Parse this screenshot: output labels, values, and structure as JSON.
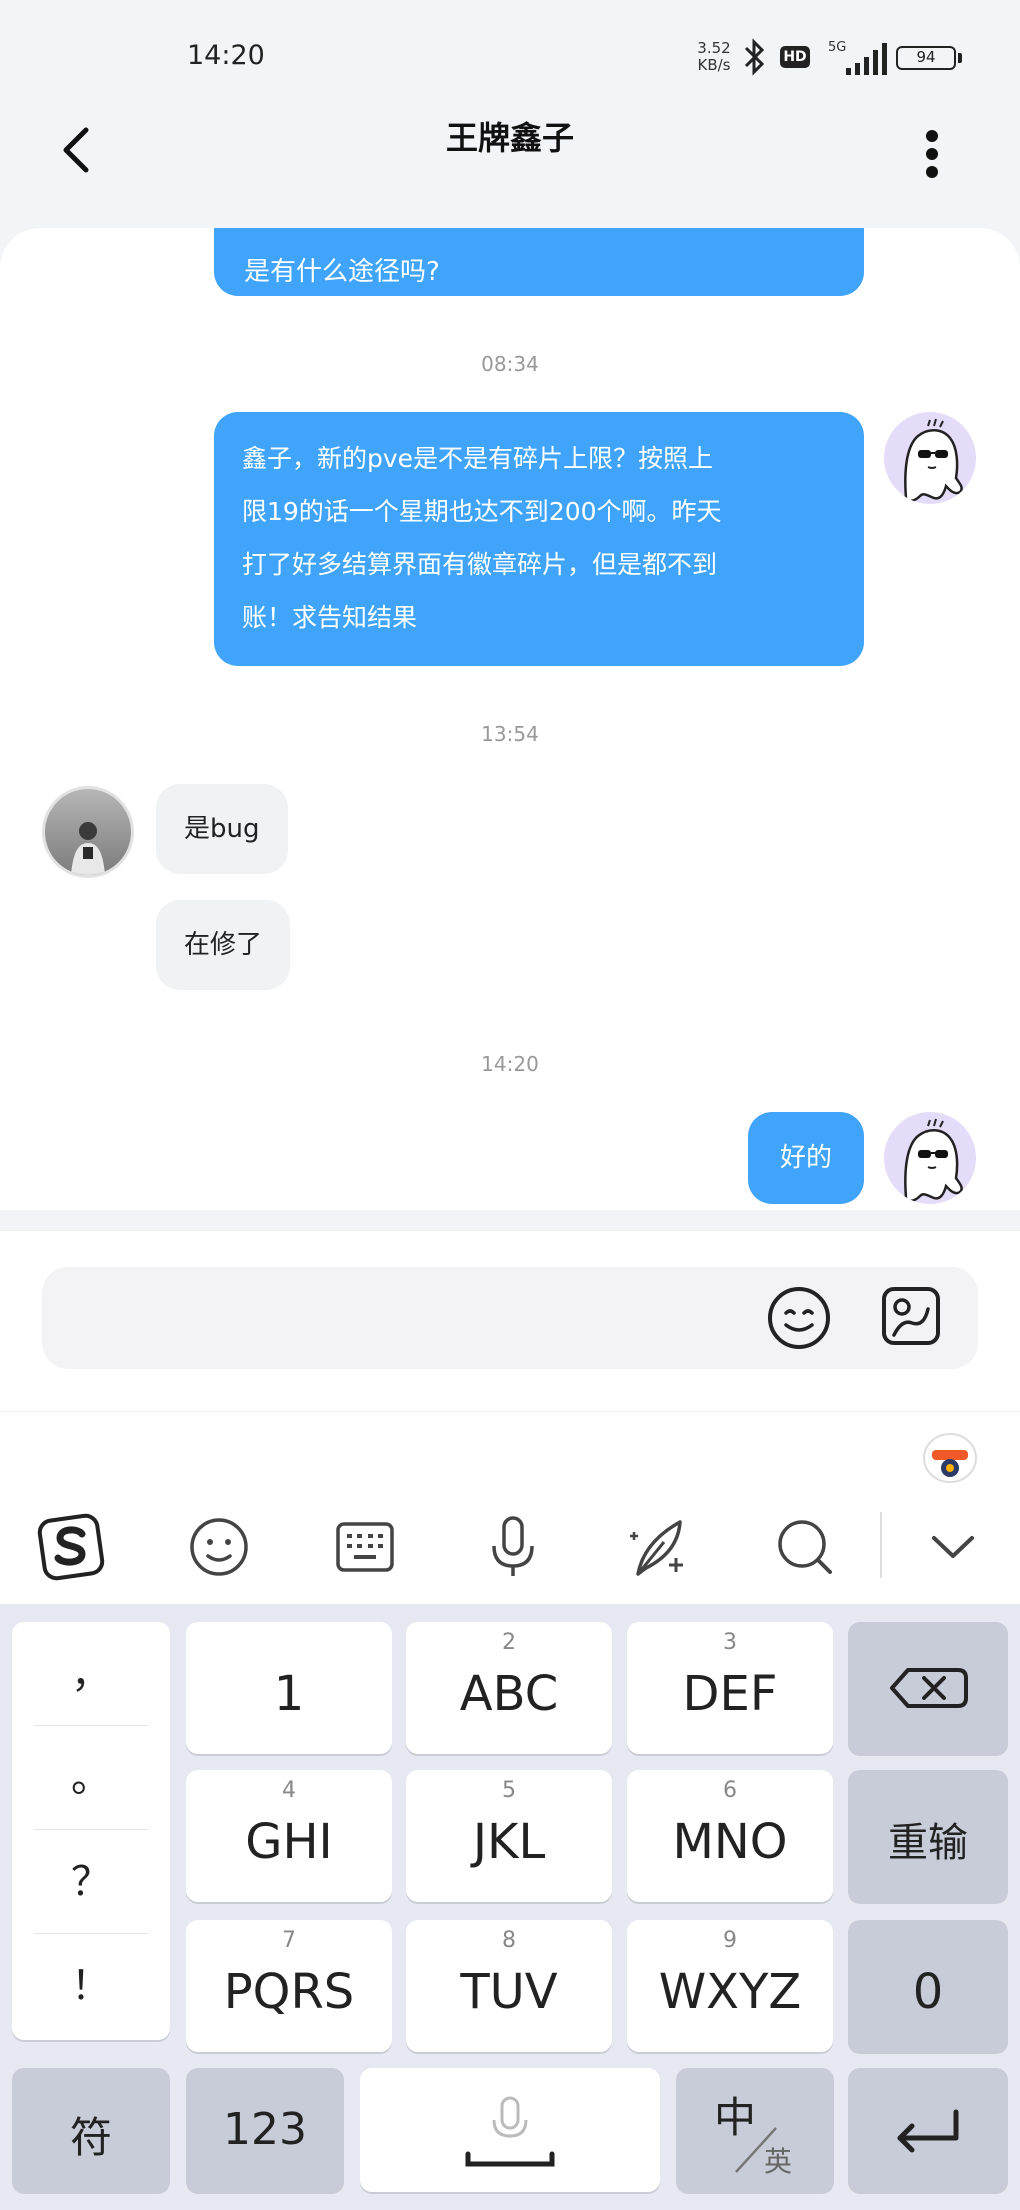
{
  "status_bar": {
    "time": "14:20",
    "net_speed_value": "3.52",
    "net_speed_unit": "KB/s",
    "hd_label": "HD",
    "network_label": "5G",
    "battery": "94"
  },
  "header": {
    "title": "王牌鑫子"
  },
  "chat": {
    "messages": [
      {
        "sender": "me",
        "text": "是有什么途径吗?"
      },
      {
        "time": "08:34"
      },
      {
        "sender": "me",
        "lines": [
          "鑫子，新的pve是不是有碎片上限？按照上",
          "限19的话一个星期也达不到200个啊。昨天",
          "打了好多结算界面有徽章碎片，但是都不到",
          "账！求告知结果"
        ]
      },
      {
        "time": "13:54"
      },
      {
        "sender": "them",
        "text": "是bug"
      },
      {
        "sender": "them",
        "text": "在修了"
      },
      {
        "time": "14:20"
      },
      {
        "sender": "me",
        "text": "好的"
      }
    ]
  },
  "input": {
    "placeholder": ""
  },
  "ime_toolbar": {
    "icons": [
      "sogou-logo-icon",
      "emoji-icon",
      "keyboard-icon",
      "microphone-icon",
      "quill-icon",
      "search-icon",
      "chevron-down-icon"
    ]
  },
  "keyboard": {
    "punctuation": [
      "，",
      "。",
      "？",
      "！"
    ],
    "keys": [
      {
        "sub": "",
        "main": "1"
      },
      {
        "sub": "2",
        "main": "ABC"
      },
      {
        "sub": "3",
        "main": "DEF"
      },
      {
        "sub": "4",
        "main": "GHI"
      },
      {
        "sub": "5",
        "main": "JKL"
      },
      {
        "sub": "6",
        "main": "MNO"
      },
      {
        "sub": "7",
        "main": "PQRS"
      },
      {
        "sub": "8",
        "main": "TUV"
      },
      {
        "sub": "9",
        "main": "WXYZ"
      }
    ],
    "reenter": "重输",
    "zero": "0",
    "symbols": "符",
    "numbers": "123",
    "lang_main": "中",
    "lang_sub": "英"
  },
  "colors": {
    "my_bubble": "#41a4fb",
    "their_bubble": "#f1f2f4"
  }
}
